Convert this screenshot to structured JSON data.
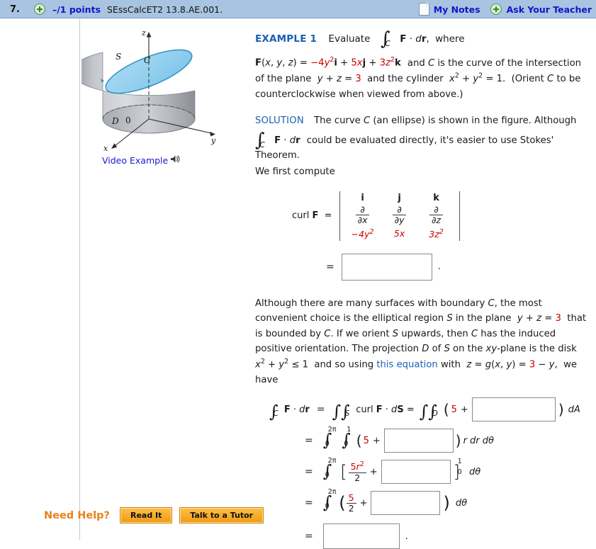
{
  "header": {
    "question_number": "7.",
    "plus_icon": "green-plus-icon",
    "points": "–/1 points",
    "question_code": "SEssCalcET2 13.8.AE.001.",
    "my_notes_label": "My Notes",
    "my_notes_icon": "note-page-icon",
    "ask_teacher_label": "Ask Your Teacher",
    "ask_teacher_icon": "green-plus-icon",
    "bar_color": "#a8c4e0",
    "link_color": "#1414c8"
  },
  "figure": {
    "name": "stokes-theorem-cylinder-figure",
    "labels": {
      "z_axis": "z",
      "y_axis": "y",
      "x_axis": "x",
      "origin": "0",
      "surface": "S",
      "curve": "C",
      "disk": "D"
    },
    "surface_color": "#9fd2ee",
    "cylinder_color": "#b9bcc0",
    "video_example_label": "Video Example",
    "video_icon": "speaker-icon"
  },
  "example": {
    "label": "EXAMPLE 1",
    "prompt_verb": "Evaluate",
    "integral_symbol": "∫",
    "integral_sub": "C",
    "integrand": "F · dr,",
    "where": "where",
    "field_definition": {
      "lhs": "F(x, y, z) =",
      "term1_coef": "−4",
      "term1_rest": "y",
      "term1_exp": "2",
      "term1_unit": "i",
      "term2_coef": "5",
      "term2_rest": "x",
      "term2_unit": "j",
      "term3_coef": "3",
      "term3_rest": "z",
      "term3_exp": "2",
      "term3_unit": "k"
    },
    "text_after_field": "and C is the curve of the intersection of the plane",
    "plane_eq_lhs": "y + z =",
    "plane_eq_rhs": "3",
    "text_cylinder": "and the cylinder",
    "cylinder_eq": "x² + y² = 1.",
    "orient_note": "(Orient C to be counterclockwise when viewed from above.)"
  },
  "solution": {
    "label": "SOLUTION",
    "line1": "The curve C (an ellipse) is shown in the figure. Although",
    "line2": "could be evaluated directly, it's easier to use Stokes' Theorem.",
    "line3": "We first compute",
    "curl_label": "curl F  =",
    "determinant": {
      "headers": [
        "i",
        "j",
        "k"
      ],
      "partials_num": "∂",
      "partials_den": [
        "∂x",
        "∂y",
        "∂z"
      ],
      "components": [
        "−4y²",
        "5x",
        "3z²"
      ],
      "component_colors": [
        "#cc0000",
        "#cc0000",
        "#cc0000"
      ]
    },
    "curl_result_value": "",
    "curl_result_placeholder": ""
  },
  "discussion": {
    "part1": "Although there are many surfaces with boundary C, the most convenient choice is the elliptical region S in the plane",
    "plane_lhs": "y + z =",
    "plane_rhs": "3",
    "part2": "that is bounded by C. If we orient S upwards, then C has the induced positive orientation. The projection D of S on the xy-plane is the disk",
    "disk_eq": "x² + y² ≤ 1",
    "part3": "and so using",
    "link_text": "this equation",
    "part4": "with",
    "g_lhs": "z = g(x, y) =",
    "g_rhs": "3",
    "g_tail": "− y,",
    "part5": "we have"
  },
  "derivation": {
    "line1": {
      "lhs_integral_sub": "C",
      "lhs_integrand": "F · dr",
      "eq": "=",
      "double_integral_sub": "S",
      "mid": "curl F · dS =",
      "double_integral_sub2": "D",
      "open_paren": "(",
      "const": "5",
      "plus": "+",
      "answer": "",
      "close_paren": ")",
      "trail": "dA"
    },
    "line2": {
      "eq": "=",
      "outer_upper": "2π",
      "outer_lower": "0",
      "inner_upper": "1",
      "inner_lower": "0",
      "open_paren": "(",
      "const": "5",
      "plus": "+",
      "answer": "",
      "close_paren": ")",
      "trail": "r dr dθ"
    },
    "line3": {
      "eq": "=",
      "upper": "2π",
      "lower": "0",
      "open_bracket": "[",
      "frac_num": "5r²",
      "frac_den": "2",
      "plus": "+",
      "answer": "",
      "close_bracket": "]",
      "eval_upper": "1",
      "eval_lower": "0",
      "trail": "dθ"
    },
    "line4": {
      "eq": "=",
      "upper": "2π",
      "lower": "0",
      "open_paren": "(",
      "frac_num": "5",
      "frac_den": "2",
      "plus": "+",
      "answer": "",
      "close_paren": ")",
      "trail": "dθ"
    },
    "line5": {
      "eq": "=",
      "answer": "",
      "period": "."
    }
  },
  "footer": {
    "need_help_label": "Need Help?",
    "need_help_color": "#e8821a",
    "read_it_label": "Read It",
    "talk_tutor_label": "Talk to a Tutor"
  }
}
